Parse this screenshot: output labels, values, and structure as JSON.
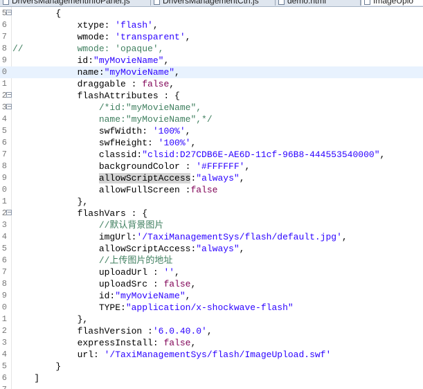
{
  "tabs": [
    {
      "label": "DriversManagementInfoPanel.js",
      "active": false
    },
    {
      "label": "DriversManagementCtrl.js",
      "active": false
    },
    {
      "label": "demo.html",
      "active": false
    },
    {
      "label": "ImageUplo",
      "active": true
    }
  ],
  "lines": [
    {
      "n": "5",
      "fold": "minus",
      "parts": [
        [
          "p",
          "        {"
        ]
      ]
    },
    {
      "n": "6",
      "parts": [
        [
          "p",
          "            xtype: "
        ],
        [
          "s",
          "'flash'"
        ],
        [
          "p",
          ","
        ]
      ]
    },
    {
      "n": "7",
      "parts": [
        [
          "p",
          "            wmode: "
        ],
        [
          "s",
          "'transparent'"
        ],
        [
          "p",
          ","
        ]
      ]
    },
    {
      "n": "8",
      "parts": [
        [
          "c",
          "//          wmode: 'opaque',"
        ]
      ]
    },
    {
      "n": "9",
      "parts": [
        [
          "p",
          "            id:"
        ],
        [
          "s",
          "\"myMovieName\""
        ],
        [
          "p",
          ","
        ]
      ]
    },
    {
      "n": "0",
      "current": true,
      "parts": [
        [
          "p",
          "            name:"
        ],
        [
          "s",
          "\"myMovieName\""
        ],
        [
          "p",
          ","
        ]
      ]
    },
    {
      "n": "1",
      "parts": [
        [
          "p",
          "            draggable : "
        ],
        [
          "k",
          "false"
        ],
        [
          "p",
          ","
        ]
      ]
    },
    {
      "n": "2",
      "fold": "minus",
      "parts": [
        [
          "p",
          "            flashAttributes : {"
        ]
      ]
    },
    {
      "n": "3",
      "fold": "minus",
      "parts": [
        [
          "p",
          "                "
        ],
        [
          "c",
          "/*id:\"myMovieName\","
        ]
      ]
    },
    {
      "n": "4",
      "parts": [
        [
          "c",
          "                name:\"myMovieName\",*/"
        ]
      ]
    },
    {
      "n": "5",
      "parts": [
        [
          "p",
          "                swfWidth: "
        ],
        [
          "s",
          "'100%'"
        ],
        [
          "p",
          ","
        ]
      ]
    },
    {
      "n": "6",
      "parts": [
        [
          "p",
          "                swfHeight: "
        ],
        [
          "s",
          "'100%'"
        ],
        [
          "p",
          ","
        ]
      ]
    },
    {
      "n": "7",
      "parts": [
        [
          "p",
          "                classid:"
        ],
        [
          "s",
          "\"clsid:D27CDB6E-AE6D-11cf-96B8-444553540000\""
        ],
        [
          "p",
          ","
        ]
      ]
    },
    {
      "n": "8",
      "parts": [
        [
          "p",
          "                backgroundColor : "
        ],
        [
          "s",
          "'#FFFFFF'"
        ],
        [
          "p",
          ","
        ]
      ]
    },
    {
      "n": "9",
      "parts": [
        [
          "p",
          "                "
        ],
        [
          "h",
          "allowScriptAccess"
        ],
        [
          "p",
          ":"
        ],
        [
          "s",
          "\"always\""
        ],
        [
          "p",
          ","
        ]
      ]
    },
    {
      "n": "0",
      "parts": [
        [
          "p",
          "                allowFullScreen :"
        ],
        [
          "k",
          "false"
        ]
      ]
    },
    {
      "n": "1",
      "parts": [
        [
          "p",
          "            },"
        ]
      ]
    },
    {
      "n": "2",
      "fold": "minus",
      "parts": [
        [
          "p",
          "            flashVars : {"
        ]
      ]
    },
    {
      "n": "3",
      "parts": [
        [
          "p",
          "                "
        ],
        [
          "c",
          "//默认背景图片"
        ]
      ]
    },
    {
      "n": "4",
      "parts": [
        [
          "p",
          "                imgUrl:"
        ],
        [
          "s",
          "'/TaxiManagementSys/flash/default.jpg'"
        ],
        [
          "p",
          ","
        ]
      ]
    },
    {
      "n": "5",
      "parts": [
        [
          "p",
          "                allowScriptAccess:"
        ],
        [
          "s",
          "\"always\""
        ],
        [
          "p",
          ","
        ]
      ]
    },
    {
      "n": "6",
      "parts": [
        [
          "p",
          "                "
        ],
        [
          "c",
          "//上传图片的地址"
        ]
      ]
    },
    {
      "n": "7",
      "parts": [
        [
          "p",
          "                uploadUrl : "
        ],
        [
          "s",
          "''"
        ],
        [
          "p",
          ","
        ]
      ]
    },
    {
      "n": "8",
      "parts": [
        [
          "p",
          "                uploadSrc : "
        ],
        [
          "k",
          "false"
        ],
        [
          "p",
          ","
        ]
      ]
    },
    {
      "n": "9",
      "parts": [
        [
          "p",
          "                id:"
        ],
        [
          "s",
          "\"myMovieName\""
        ],
        [
          "p",
          ","
        ]
      ]
    },
    {
      "n": "0",
      "parts": [
        [
          "p",
          "                TYPE:"
        ],
        [
          "s",
          "\"application/x-shockwave-flash\""
        ]
      ]
    },
    {
      "n": "1",
      "parts": [
        [
          "p",
          "            },"
        ]
      ]
    },
    {
      "n": "2",
      "parts": [
        [
          "p",
          "            flashVersion :"
        ],
        [
          "s",
          "'6.0.40.0'"
        ],
        [
          "p",
          ","
        ]
      ]
    },
    {
      "n": "3",
      "parts": [
        [
          "p",
          "            expressInstall: "
        ],
        [
          "k",
          "false"
        ],
        [
          "p",
          ","
        ]
      ]
    },
    {
      "n": "4",
      "parts": [
        [
          "p",
          "            url: "
        ],
        [
          "s",
          "'/TaxiManagementSys/flash/ImageUpload.swf'"
        ]
      ]
    },
    {
      "n": "5",
      "parts": [
        [
          "p",
          "        }"
        ]
      ]
    },
    {
      "n": "6",
      "parts": [
        [
          "p",
          "    ]"
        ]
      ]
    },
    {
      "n": "7",
      "parts": [
        [
          "p",
          ""
        ]
      ]
    }
  ],
  "colors": {
    "keyword": "#7f0055",
    "string": "#2a00ff",
    "comment": "#3f7f5f",
    "current_line": "#e8f2fe",
    "occurrence_highlight": "#d4d4d4"
  },
  "icons": {
    "tab_file": "js-file-icon",
    "fold": "fold-collapse-icon"
  }
}
